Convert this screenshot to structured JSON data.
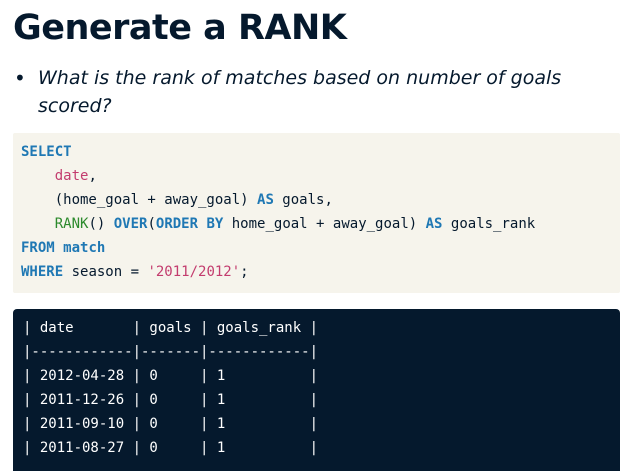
{
  "slide": {
    "title": "Generate a RANK",
    "bullet_marker": "•",
    "bullet_text": "What is the rank of matches based on number of goals scored?"
  },
  "query": {
    "line1": {
      "kw": "SELECT"
    },
    "line2": {
      "indent": "    ",
      "col": "date",
      "punct": ","
    },
    "line3": {
      "indent": "    ",
      "expr": "(home_goal + away_goal) ",
      "kw": "AS",
      "rest": " goals,"
    },
    "line4": {
      "indent": "    ",
      "fn": "RANK",
      "paren": "() ",
      "kw1": "OVER",
      "open": "(",
      "kw2": "ORDER BY",
      "expr": " home_goal + away_goal) ",
      "kw3": "AS",
      "rest": " goals_rank"
    },
    "line5": {
      "kw1": "FROM",
      "sp": " ",
      "kw2": "match"
    },
    "line6": {
      "kw": "WHERE",
      "mid": " season = ",
      "str": "'2011/2012'",
      "end": ";"
    }
  },
  "result": {
    "header": "| date       | goals | goals_rank |",
    "separator": "|------------|-------|------------|",
    "rows": [
      "| 2012-04-28 | 0     | 1          |",
      "| 2011-12-26 | 0     | 1          |",
      "| 2011-09-10 | 0     | 1          |",
      "| 2011-08-27 | 0     | 1          |"
    ]
  }
}
